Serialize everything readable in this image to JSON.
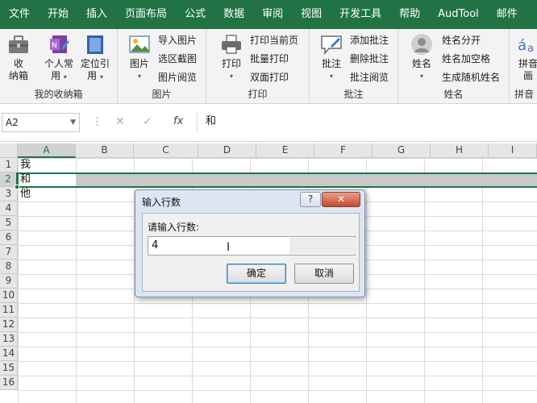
{
  "menu": [
    "文件",
    "开始",
    "插入",
    "页面布局",
    "公式",
    "数据",
    "审阅",
    "视图",
    "开发工具",
    "帮助",
    "AudTool",
    "邮件"
  ],
  "ribbon": {
    "groups": {
      "collection": {
        "label": "我的收纳箱",
        "buttons": [
          {
            "label1": "收",
            "label2": "纳箱"
          },
          {
            "label1": "个人常",
            "label2": "用"
          },
          {
            "label1": "定位引",
            "label2": "用"
          }
        ]
      },
      "picture": {
        "label": "图片",
        "big": "图片",
        "items": [
          "导入图片",
          "选区截图",
          "图片阅览"
        ]
      },
      "print": {
        "label": "打印",
        "big": "打印",
        "items": [
          "打印当前页",
          "批量打印",
          "双面打印"
        ]
      },
      "comment": {
        "label": "批注",
        "big": "批注",
        "items": [
          "添加批注",
          "删除批注",
          "批注阅览"
        ]
      },
      "name": {
        "label": "姓名",
        "big": "姓名",
        "items": [
          "姓名分开",
          "姓名加空格",
          "生成随机姓名"
        ]
      },
      "pinyin": {
        "label": "拼音",
        "big1": "拼音",
        "big2": "画"
      }
    }
  },
  "formula_bar": {
    "name_box": "A2",
    "fx": "fx",
    "value": "和"
  },
  "grid": {
    "columns": [
      "A",
      "B",
      "C",
      "D",
      "E",
      "F",
      "G",
      "H",
      "I"
    ],
    "rows": [
      "1",
      "2",
      "3",
      "4",
      "5",
      "6",
      "7",
      "8",
      "9",
      "10",
      "11",
      "12",
      "13",
      "14",
      "15",
      "16"
    ],
    "cells": {
      "A1": "我",
      "A2": "和",
      "A3": "他"
    }
  },
  "dialog": {
    "title": "输入行数",
    "help": "?",
    "close": "✕",
    "prompt": "请输入行数:",
    "value": "4",
    "ok": "确定",
    "cancel": "取消"
  },
  "colors": {
    "accent": "#217346",
    "dialog_bg": "#dce6f2",
    "close_red": "#c24a31"
  }
}
